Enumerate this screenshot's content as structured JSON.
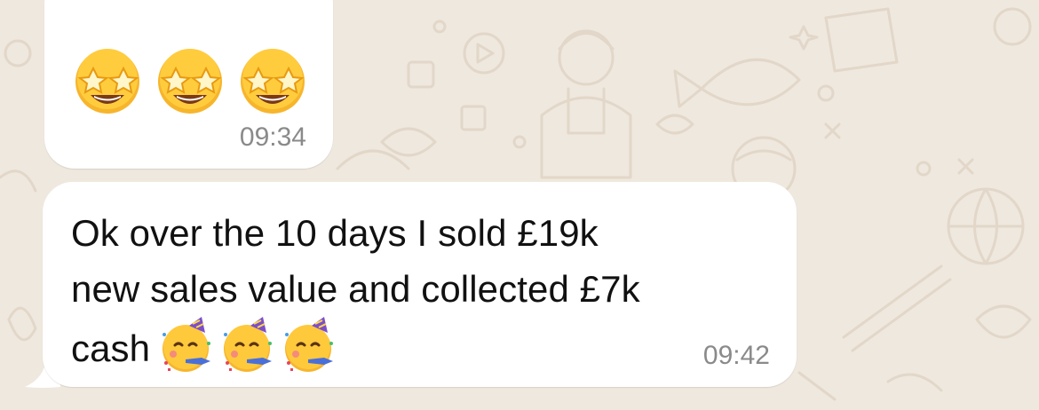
{
  "messages": [
    {
      "emojis": [
        "star-struck",
        "star-struck",
        "star-struck"
      ],
      "time": "09:34"
    },
    {
      "text_lines": [
        "Ok over the 10 days I sold £19k",
        "new sales value and collected £7k",
        "cash"
      ],
      "emojis": [
        "partying-face",
        "partying-face",
        "partying-face"
      ],
      "time": "09:42"
    }
  ],
  "colors": {
    "wallpaper": "#efe8de",
    "bubble": "#ffffff",
    "text": "#111111",
    "timestamp": "#8a8a8a"
  }
}
